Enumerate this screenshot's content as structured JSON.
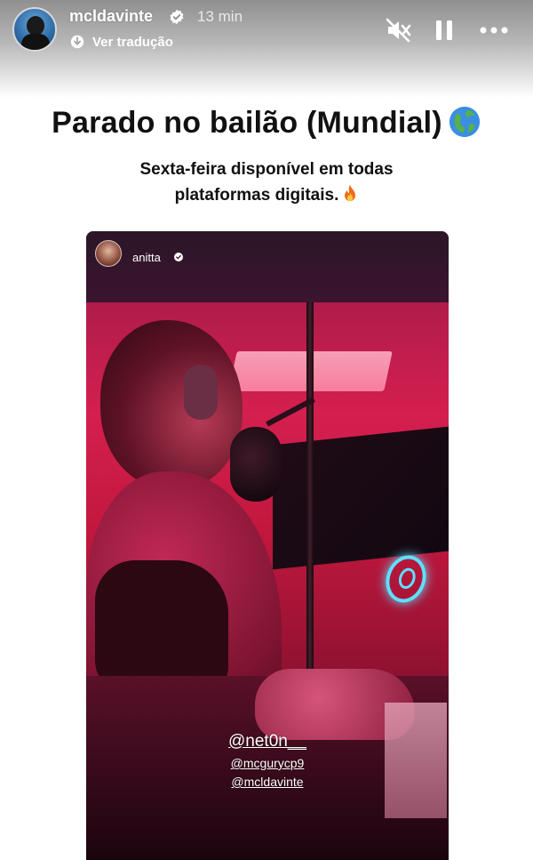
{
  "header": {
    "username": "mcldavinte",
    "time": "13 min",
    "translate_label": "Ver tradução",
    "icons": [
      "verified-badge-icon",
      "translate-icon",
      "mute-icon",
      "pause-icon",
      "more-icon"
    ]
  },
  "caption": {
    "title": "Parado no bailão (Mundial)",
    "subtitle_line1": "Sexta-feira  disponível em todas",
    "subtitle_line2": "plataformas digitais."
  },
  "reshared_story": {
    "username": "anitta",
    "mentions": [
      "@net0n__",
      "@mcgurycp9",
      "@mcldavinte"
    ]
  },
  "colors": {
    "accent_red": "#d41f4f",
    "neon": "#5de0ff"
  }
}
